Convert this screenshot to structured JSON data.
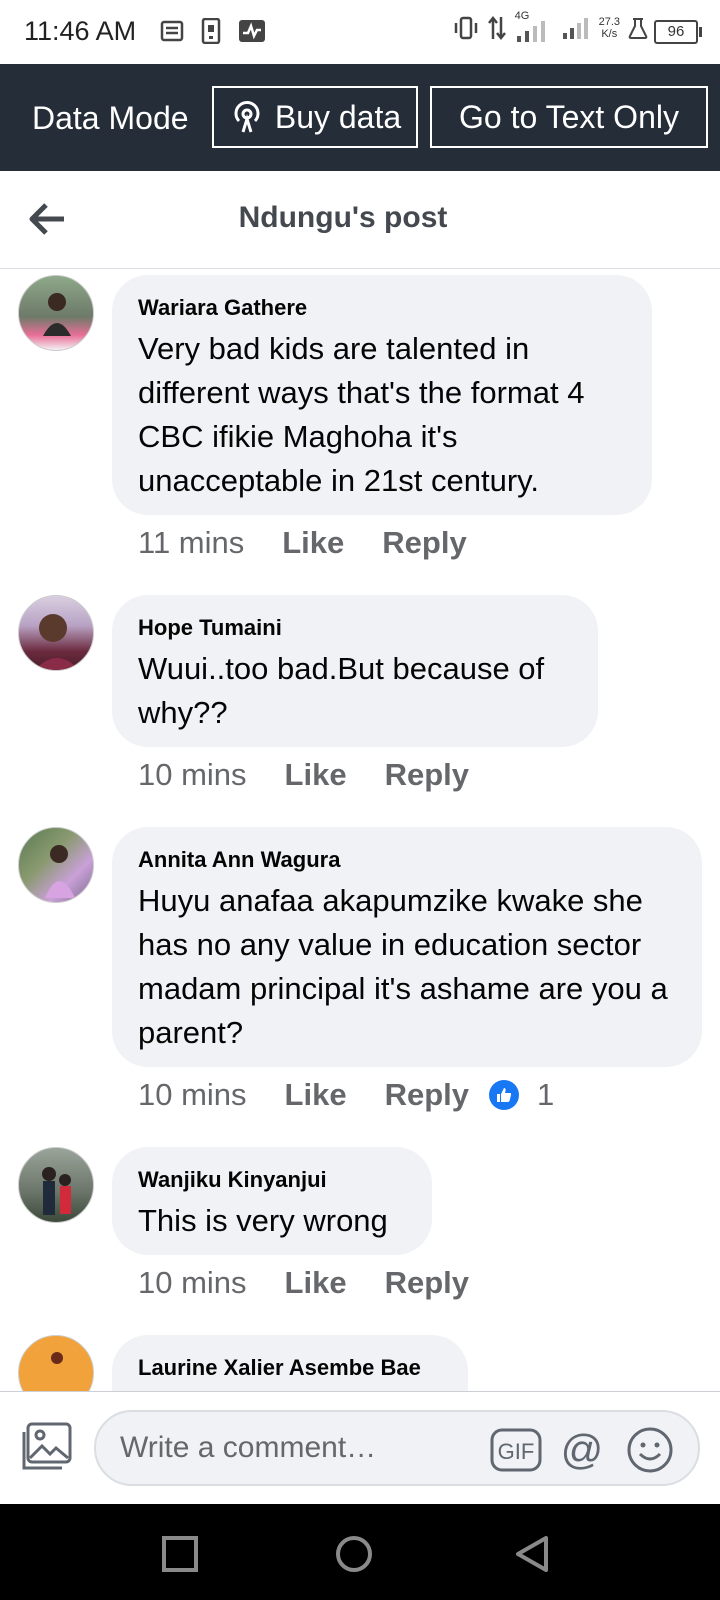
{
  "status_bar": {
    "time": "11:46 AM",
    "network": "4G",
    "speed_value": "27.3",
    "speed_unit": "K/s",
    "battery": "96",
    "icons": [
      "message-icon",
      "sim-icon",
      "activity-icon",
      "vibrate-icon",
      "data-arrows-icon",
      "signal-icon",
      "signal-icon",
      "flask-icon",
      "battery-icon"
    ]
  },
  "data_banner": {
    "mode_label": "Data Mode",
    "buy_label": "Buy data",
    "text_only_label": "Go to Text Only"
  },
  "header": {
    "title": "Ndungu's post"
  },
  "comments": [
    {
      "author": "Wariara Gathere",
      "text": "Very bad kids are talented in different ways that's the format 4 CBC ifikie Maghoha it's unacceptable in 21st century.",
      "time": "11 mins",
      "like": "Like",
      "reply": "Reply"
    },
    {
      "author": "Hope Tumaini",
      "text": "Wuui..too bad.But because of why??",
      "time": "10 mins",
      "like": "Like",
      "reply": "Reply"
    },
    {
      "author": "Annita Ann Wagura",
      "text": "Huyu anafaa akapumzike kwake she has no any value in education sector madam principal it's ashame are you a parent?",
      "time": "10 mins",
      "like": "Like",
      "reply": "Reply",
      "reaction_count": "1"
    },
    {
      "author": "Wanjiku Kinyanjui",
      "text": "This is very wrong",
      "time": "10 mins",
      "like": "Like",
      "reply": "Reply"
    },
    {
      "author": "Laurine Xalier Asembe Bae",
      "text": "",
      "time": "",
      "like": "",
      "reply": ""
    }
  ],
  "composer": {
    "placeholder": "Write a comment…",
    "gif_label": "GIF",
    "mention_label": "@"
  },
  "colors": {
    "banner_bg": "#252d38",
    "bubble_bg": "#f0f2f5",
    "meta_text": "#65676b",
    "like_blue": "#1877f2"
  }
}
